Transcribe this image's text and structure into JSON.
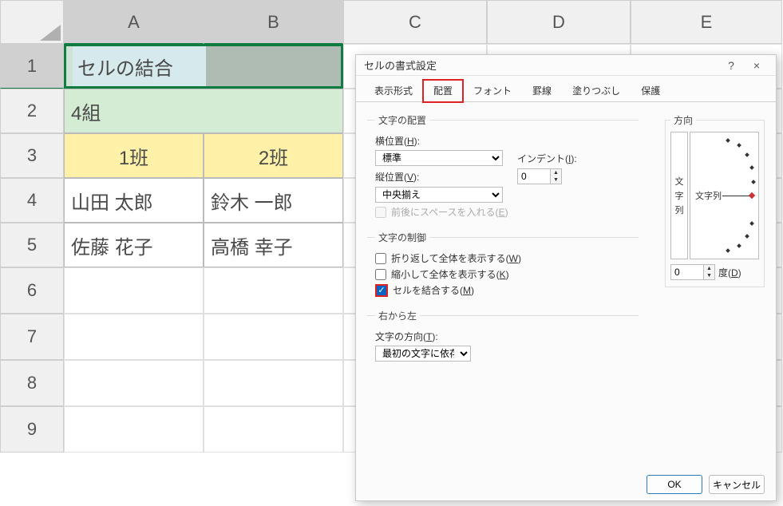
{
  "columns": [
    "A",
    "B",
    "C",
    "D",
    "E"
  ],
  "rows": [
    "1",
    "2",
    "3",
    "4",
    "5",
    "6",
    "7",
    "8",
    "9"
  ],
  "cells": {
    "a1": "セルの結合",
    "a2": "4組",
    "a3": "1班",
    "b3": "2班",
    "a4": "山田 太郎",
    "b4": "鈴木 一郎",
    "a5": "佐藤 花子",
    "b5": "高橋 幸子"
  },
  "dialog": {
    "title": "セルの書式設定",
    "help": "?",
    "close": "×",
    "tabs": {
      "display": "表示形式",
      "align": "配置",
      "font": "フォント",
      "border": "罫線",
      "fill": "塗りつぶし",
      "protect": "保護"
    },
    "text_align_group": "文字の配置",
    "halign_label": "横位置(H):",
    "halign_value": "標準",
    "indent_label": "インデント(I):",
    "indent_value": "0",
    "valign_label": "縦位置(V):",
    "valign_value": "中央揃え",
    "distribute_label": "前後にスペースを入れる(E)",
    "control_group": "文字の制御",
    "wrap_label": "折り返して全体を表示する(W)",
    "shrink_label": "縮小して全体を表示する(K)",
    "merge_label": "セルを結合する(M)",
    "rtl_group": "右から左",
    "textdir_label": "文字の方向(T):",
    "textdir_value": "最初の文字に依存",
    "orient_group": "方向",
    "orient_vertical": "文字列",
    "orient_text": "文字列",
    "deg_value": "0",
    "deg_label": "度(D)",
    "ok": "OK",
    "cancel": "キャンセル"
  }
}
